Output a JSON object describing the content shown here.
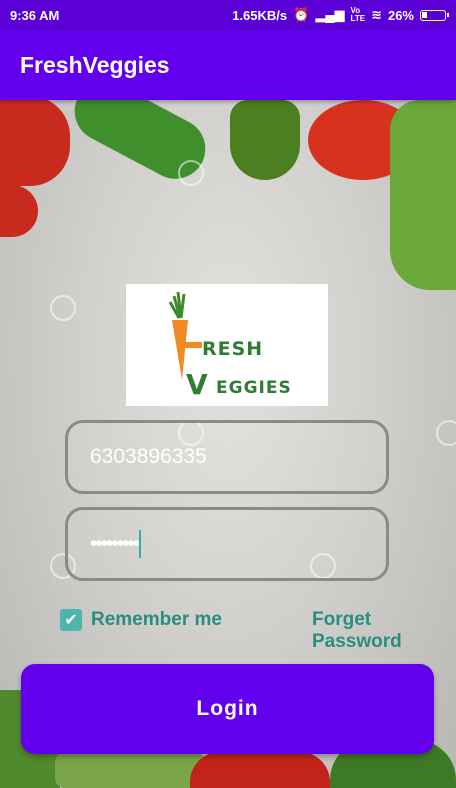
{
  "status_bar": {
    "time": "9:36 AM",
    "network_speed": "1.65KB/s",
    "battery": "26%",
    "battery_level": 0.26,
    "icons": [
      "alarm-icon",
      "signal-icon",
      "volte-icon",
      "wifi-icon",
      "battery-icon"
    ]
  },
  "app_bar": {
    "title": "FreshVeggies"
  },
  "logo": {
    "line1": "RESH",
    "line2": "EGGIES",
    "initial1": "F",
    "initial2": "V"
  },
  "form": {
    "phone_value": "6303896335",
    "password_mask": "•••••••••"
  },
  "options": {
    "remember_label": "Remember me",
    "remember_checked": true,
    "forget_label": "Forget Password"
  },
  "actions": {
    "login_label": "Login"
  },
  "colors": {
    "primary": "#6200ee",
    "status_bar": "#5a00d6",
    "accent": "#4db6ac",
    "link": "#2a8d84"
  }
}
